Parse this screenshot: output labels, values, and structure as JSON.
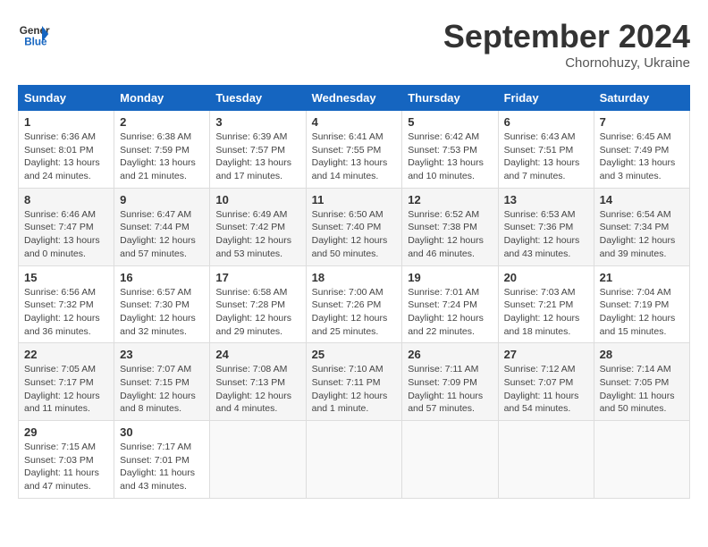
{
  "header": {
    "logo_line1": "General",
    "logo_line2": "Blue",
    "month": "September 2024",
    "location": "Chornohuzy, Ukraine"
  },
  "weekdays": [
    "Sunday",
    "Monday",
    "Tuesday",
    "Wednesday",
    "Thursday",
    "Friday",
    "Saturday"
  ],
  "weeks": [
    [
      {
        "day": "1",
        "detail": "Sunrise: 6:36 AM\nSunset: 8:01 PM\nDaylight: 13 hours\nand 24 minutes."
      },
      {
        "day": "2",
        "detail": "Sunrise: 6:38 AM\nSunset: 7:59 PM\nDaylight: 13 hours\nand 21 minutes."
      },
      {
        "day": "3",
        "detail": "Sunrise: 6:39 AM\nSunset: 7:57 PM\nDaylight: 13 hours\nand 17 minutes."
      },
      {
        "day": "4",
        "detail": "Sunrise: 6:41 AM\nSunset: 7:55 PM\nDaylight: 13 hours\nand 14 minutes."
      },
      {
        "day": "5",
        "detail": "Sunrise: 6:42 AM\nSunset: 7:53 PM\nDaylight: 13 hours\nand 10 minutes."
      },
      {
        "day": "6",
        "detail": "Sunrise: 6:43 AM\nSunset: 7:51 PM\nDaylight: 13 hours\nand 7 minutes."
      },
      {
        "day": "7",
        "detail": "Sunrise: 6:45 AM\nSunset: 7:49 PM\nDaylight: 13 hours\nand 3 minutes."
      }
    ],
    [
      {
        "day": "8",
        "detail": "Sunrise: 6:46 AM\nSunset: 7:47 PM\nDaylight: 13 hours\nand 0 minutes."
      },
      {
        "day": "9",
        "detail": "Sunrise: 6:47 AM\nSunset: 7:44 PM\nDaylight: 12 hours\nand 57 minutes."
      },
      {
        "day": "10",
        "detail": "Sunrise: 6:49 AM\nSunset: 7:42 PM\nDaylight: 12 hours\nand 53 minutes."
      },
      {
        "day": "11",
        "detail": "Sunrise: 6:50 AM\nSunset: 7:40 PM\nDaylight: 12 hours\nand 50 minutes."
      },
      {
        "day": "12",
        "detail": "Sunrise: 6:52 AM\nSunset: 7:38 PM\nDaylight: 12 hours\nand 46 minutes."
      },
      {
        "day": "13",
        "detail": "Sunrise: 6:53 AM\nSunset: 7:36 PM\nDaylight: 12 hours\nand 43 minutes."
      },
      {
        "day": "14",
        "detail": "Sunrise: 6:54 AM\nSunset: 7:34 PM\nDaylight: 12 hours\nand 39 minutes."
      }
    ],
    [
      {
        "day": "15",
        "detail": "Sunrise: 6:56 AM\nSunset: 7:32 PM\nDaylight: 12 hours\nand 36 minutes."
      },
      {
        "day": "16",
        "detail": "Sunrise: 6:57 AM\nSunset: 7:30 PM\nDaylight: 12 hours\nand 32 minutes."
      },
      {
        "day": "17",
        "detail": "Sunrise: 6:58 AM\nSunset: 7:28 PM\nDaylight: 12 hours\nand 29 minutes."
      },
      {
        "day": "18",
        "detail": "Sunrise: 7:00 AM\nSunset: 7:26 PM\nDaylight: 12 hours\nand 25 minutes."
      },
      {
        "day": "19",
        "detail": "Sunrise: 7:01 AM\nSunset: 7:24 PM\nDaylight: 12 hours\nand 22 minutes."
      },
      {
        "day": "20",
        "detail": "Sunrise: 7:03 AM\nSunset: 7:21 PM\nDaylight: 12 hours\nand 18 minutes."
      },
      {
        "day": "21",
        "detail": "Sunrise: 7:04 AM\nSunset: 7:19 PM\nDaylight: 12 hours\nand 15 minutes."
      }
    ],
    [
      {
        "day": "22",
        "detail": "Sunrise: 7:05 AM\nSunset: 7:17 PM\nDaylight: 12 hours\nand 11 minutes."
      },
      {
        "day": "23",
        "detail": "Sunrise: 7:07 AM\nSunset: 7:15 PM\nDaylight: 12 hours\nand 8 minutes."
      },
      {
        "day": "24",
        "detail": "Sunrise: 7:08 AM\nSunset: 7:13 PM\nDaylight: 12 hours\nand 4 minutes."
      },
      {
        "day": "25",
        "detail": "Sunrise: 7:10 AM\nSunset: 7:11 PM\nDaylight: 12 hours\nand 1 minute."
      },
      {
        "day": "26",
        "detail": "Sunrise: 7:11 AM\nSunset: 7:09 PM\nDaylight: 11 hours\nand 57 minutes."
      },
      {
        "day": "27",
        "detail": "Sunrise: 7:12 AM\nSunset: 7:07 PM\nDaylight: 11 hours\nand 54 minutes."
      },
      {
        "day": "28",
        "detail": "Sunrise: 7:14 AM\nSunset: 7:05 PM\nDaylight: 11 hours\nand 50 minutes."
      }
    ],
    [
      {
        "day": "29",
        "detail": "Sunrise: 7:15 AM\nSunset: 7:03 PM\nDaylight: 11 hours\nand 47 minutes."
      },
      {
        "day": "30",
        "detail": "Sunrise: 7:17 AM\nSunset: 7:01 PM\nDaylight: 11 hours\nand 43 minutes."
      },
      {
        "day": "",
        "detail": ""
      },
      {
        "day": "",
        "detail": ""
      },
      {
        "day": "",
        "detail": ""
      },
      {
        "day": "",
        "detail": ""
      },
      {
        "day": "",
        "detail": ""
      }
    ]
  ]
}
